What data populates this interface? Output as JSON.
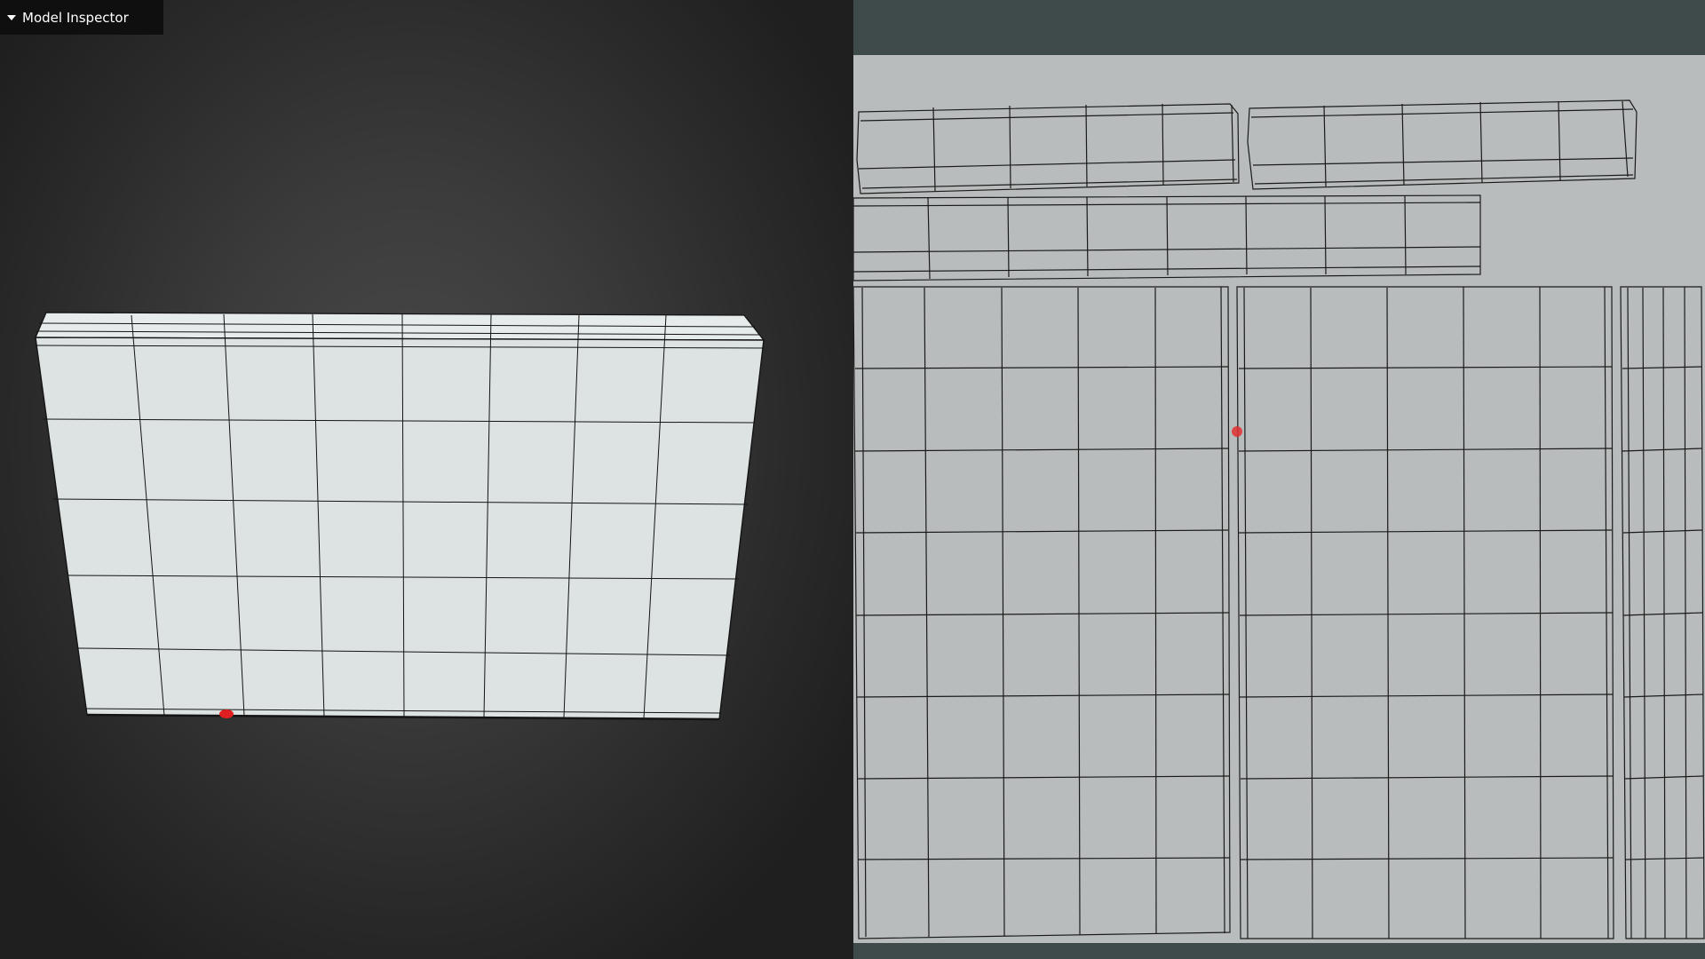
{
  "inspector": {
    "title": "Model Inspector",
    "caret_icon": "caret-down-icon"
  },
  "colors": {
    "viewport_bg": "#3b3b3b",
    "model_face": "#dde3e3",
    "wire": "#141414",
    "uv_frame": "#3f4a4a",
    "uv_canvas": "#b9bcbc",
    "marker": "#e02020"
  }
}
